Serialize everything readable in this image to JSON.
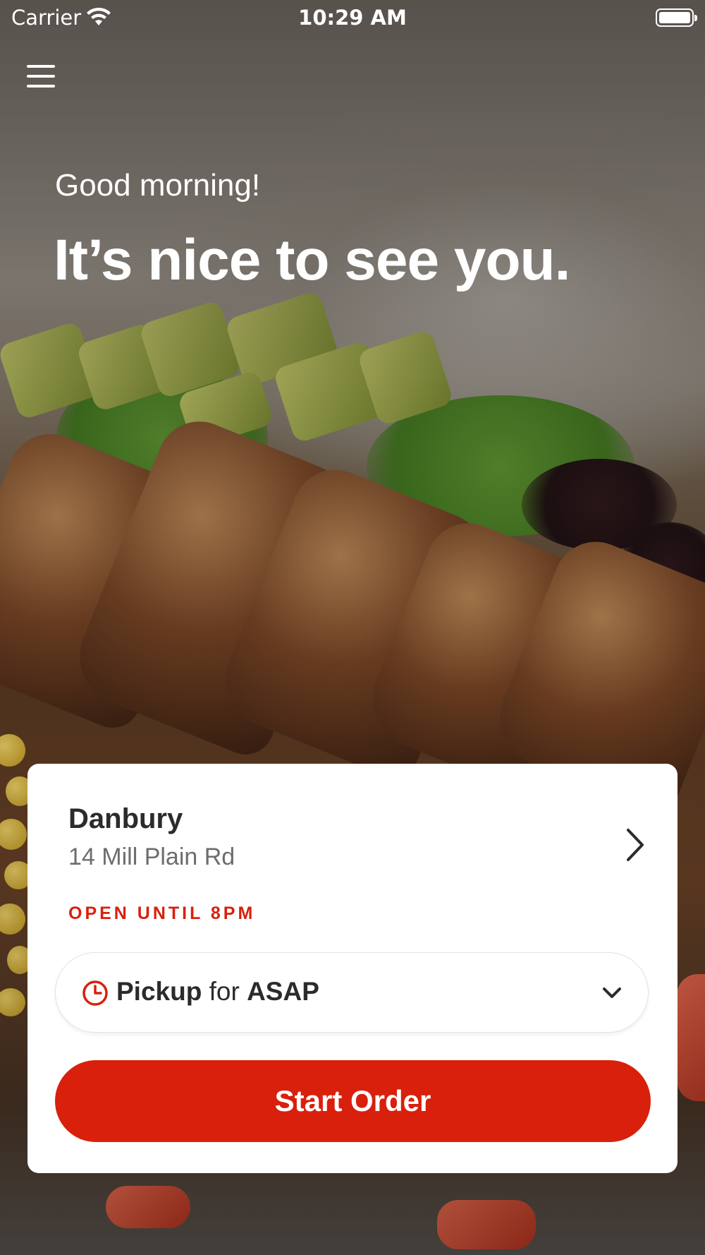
{
  "status_bar": {
    "carrier": "Carrier",
    "time": "10:29 AM"
  },
  "header": {
    "menu_icon": "hamburger-menu-icon"
  },
  "hero": {
    "greeting": "Good morning!",
    "headline": "It’s nice to see you."
  },
  "location": {
    "name": "Danbury",
    "address": "14 Mill Plain Rd",
    "status": "OPEN UNTIL 8PM",
    "status_color": "#d8200c"
  },
  "order_mode": {
    "mode": "Pickup",
    "connector": "for",
    "time": "ASAP",
    "icon": "clock-icon"
  },
  "actions": {
    "start_order": "Start Order",
    "accent_color": "#d8200c"
  }
}
